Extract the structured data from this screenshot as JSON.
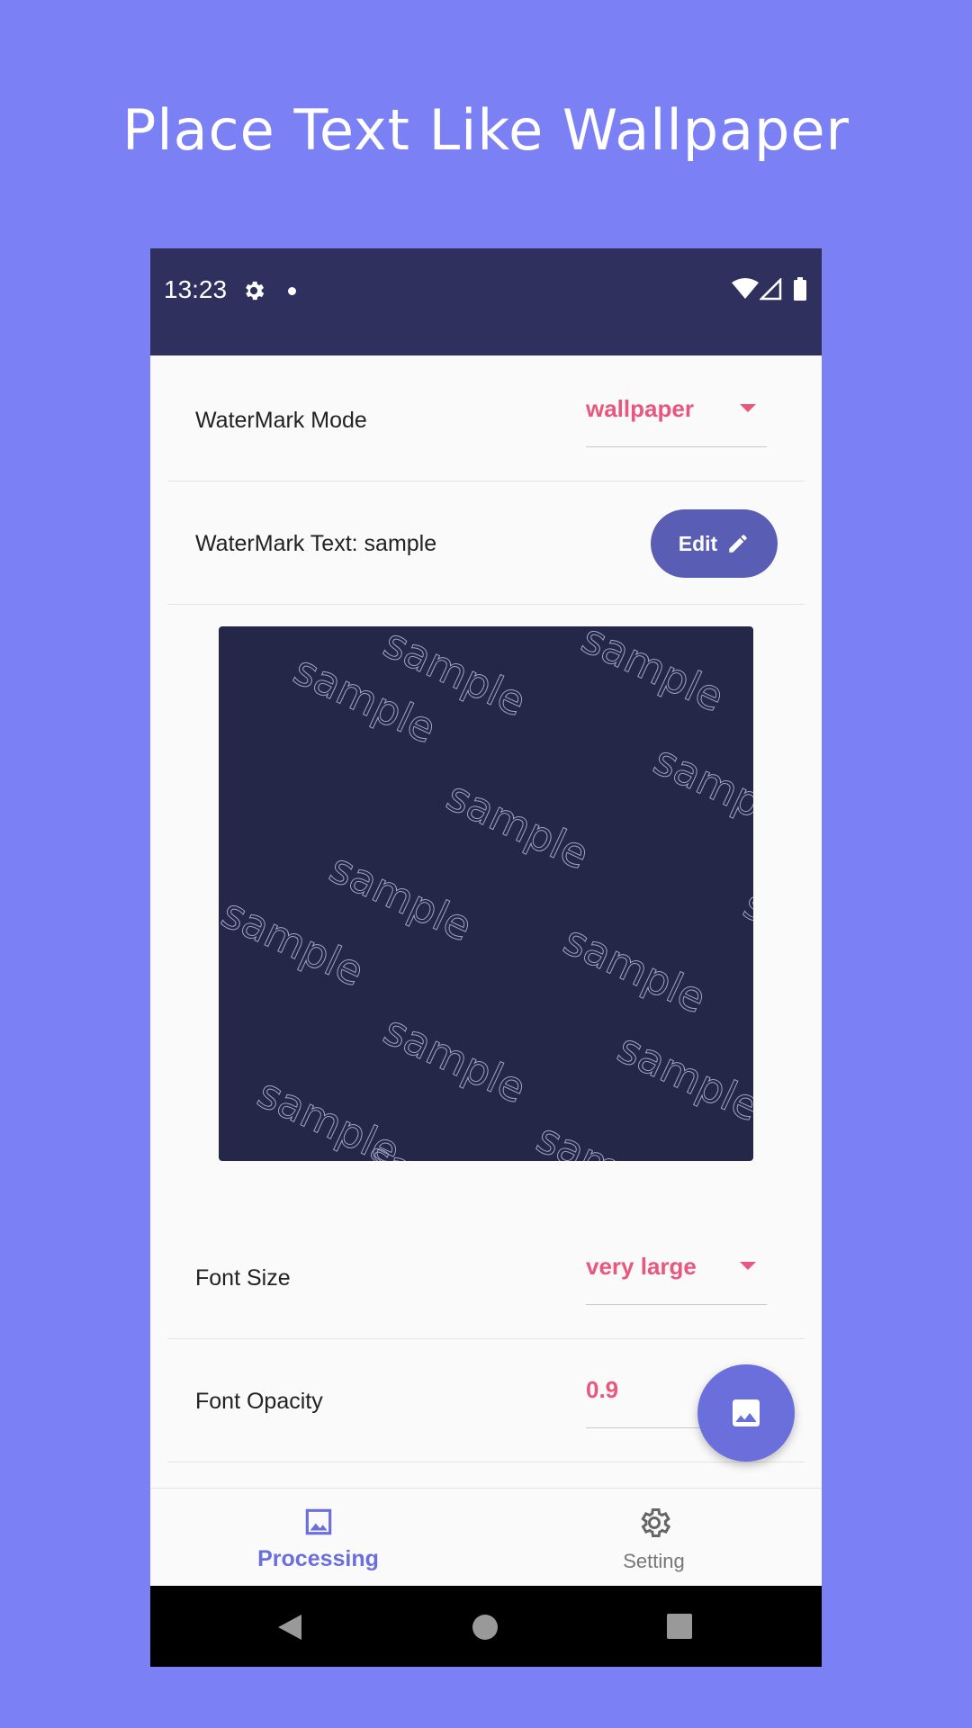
{
  "headline": "Place Text Like Wallpaper",
  "status_bar": {
    "time": "13:23",
    "icons": [
      "gear-icon",
      "notification-dot-icon",
      "wifi-icon",
      "cell-signal-icon",
      "battery-icon"
    ]
  },
  "watermark_mode": {
    "label": "WaterMark Mode",
    "value": "wallpaper"
  },
  "watermark_text": {
    "label": "WaterMark Text: sample",
    "edit_label": "Edit",
    "sample": "sample"
  },
  "font_size": {
    "label": "Font Size",
    "value": "very large"
  },
  "font_opacity": {
    "label": "Font Opacity",
    "value": "0.9"
  },
  "bottom_nav": {
    "items": [
      {
        "label": "Processing",
        "icon": "image-icon",
        "active": true
      },
      {
        "label": "Setting",
        "icon": "gear-icon",
        "active": false
      }
    ]
  },
  "fab": {
    "icon": "image-icon"
  },
  "system_nav": {
    "icons": [
      "back-icon",
      "home-icon",
      "recents-icon"
    ]
  },
  "colors": {
    "background": "#7b80f5",
    "status_bar": "#30305f",
    "accent_pink": "#e8577e",
    "primary": "#5a5db4",
    "fab": "#6b6fdc",
    "preview_bg": "#252748"
  }
}
